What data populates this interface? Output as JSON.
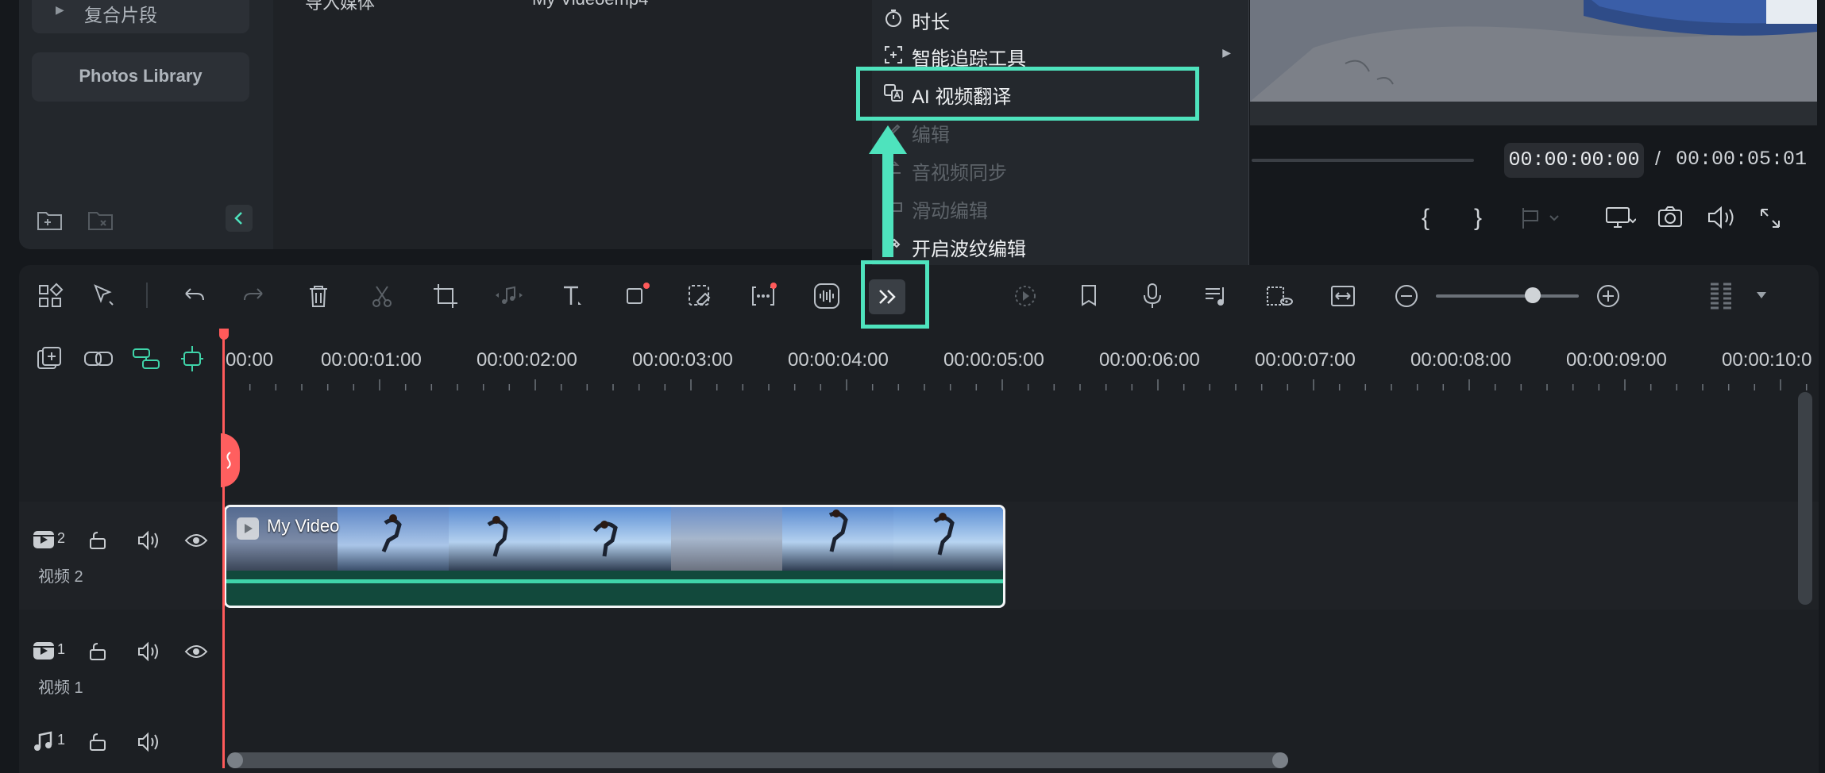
{
  "media": {
    "sidebar": {
      "compound_label": "复合片段",
      "photos_library_label": "Photos Library"
    },
    "header_partial_1": "导入媒体",
    "header_partial_2": "My Videoemp4"
  },
  "preview": {
    "current_time": "00:00:00:00",
    "separator": "/",
    "total_time": "00:00:05:01"
  },
  "context_menu": {
    "items": [
      {
        "label": "时长",
        "icon": "stopwatch-icon",
        "enabled": true
      },
      {
        "label": "智能追踪工具",
        "icon": "tracking-icon",
        "enabled": true,
        "submenu": true
      },
      {
        "label": "AI 视频翻译",
        "icon": "translate-icon",
        "enabled": true,
        "highlighted": true
      },
      {
        "label": "编辑",
        "icon": "edit-icon",
        "enabled": false
      },
      {
        "label": "音视频同步",
        "icon": "sync-icon",
        "enabled": false
      },
      {
        "label": "滑动编辑",
        "icon": "slide-icon",
        "enabled": false
      },
      {
        "label": "开启波纹编辑",
        "icon": "ripple-icon",
        "enabled": true
      }
    ]
  },
  "timeline": {
    "ruler_labels": [
      "00:00",
      "00:00:01:00",
      "00:00:02:00",
      "00:00:03:00",
      "00:00:04:00",
      "00:00:05:00",
      "00:00:06:00",
      "00:00:07:00",
      "00:00:08:00",
      "00:00:09:00",
      "00:00:10:0"
    ],
    "tracks": [
      {
        "name": "视频 2",
        "number": "2"
      },
      {
        "name": "视频 1",
        "number": "1"
      },
      {
        "name": "",
        "number": "1"
      }
    ],
    "clip_title": "My Video"
  },
  "colors": {
    "accent_highlight": "#4ee3bd",
    "playhead": "#ff5a5a",
    "clip_bg": "#12493c"
  }
}
